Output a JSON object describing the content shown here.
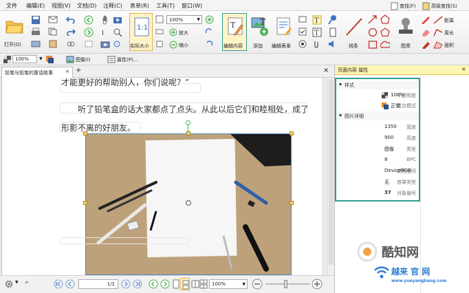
{
  "menu": [
    "文件",
    "编辑(E)",
    "视图(V)",
    "文档(D)",
    "注释(C)",
    "表单(R)",
    "工具(T)",
    "窗口(W)"
  ],
  "ribbon": {
    "open": "打开(O)",
    "actual_size": "实际大小",
    "zoom_in": "放大",
    "zoom_out": "缩小",
    "zoom_value": "100%",
    "edit_content": "编辑内容",
    "add": "添加",
    "edit_form": "编辑表单",
    "lines": "线条",
    "stamp": "图章",
    "find": "查找(F)",
    "advanced_find": "高级查找(S)",
    "distance": "距离",
    "perimeter": "周长",
    "area": "面积"
  },
  "propbar": {
    "opacity": "100%",
    "image": "图像(I)",
    "properties": "属性(P)..."
  },
  "tab": {
    "title": "铅笔与铅笔的童话故事"
  },
  "document": {
    "line1": "才能更好的帮助别人，你们说呢？”",
    "line2": "听了铅笔盒的话大家都点了点头。从此以后它们和睦相处，成了",
    "line3": "形影不离的好朋友。"
  },
  "panel": {
    "title": "页面内容 属性",
    "style_section": "样式",
    "detail_section": "图片详细",
    "style_rows": [
      {
        "k": "不透明度",
        "v": "100%"
      },
      {
        "k": "混合模式",
        "v": "正常"
      }
    ],
    "detail_rows": [
      {
        "k": "宽度",
        "v": "1350"
      },
      {
        "k": "高度",
        "v": "900"
      },
      {
        "k": "类型",
        "v": "图像"
      },
      {
        "k": "BPC",
        "v": "8"
      },
      {
        "k": "颜色空间",
        "v": "DeviceRGB"
      },
      {
        "k": "遮罩类型",
        "v": "无"
      },
      {
        "k": "对象编号",
        "v": "37"
      }
    ]
  },
  "status": {
    "page": "1/1",
    "zoom": "100%"
  },
  "watermark": {
    "text1": "酷知网",
    "text2": "越来 官 网",
    "url": "www.yueyangbang.com"
  },
  "colors": {
    "accent": "#2a9d8f",
    "panel_head": "#fff5b3",
    "link_blue": "#3b73c9",
    "ribbon_red": "#c0392b"
  }
}
